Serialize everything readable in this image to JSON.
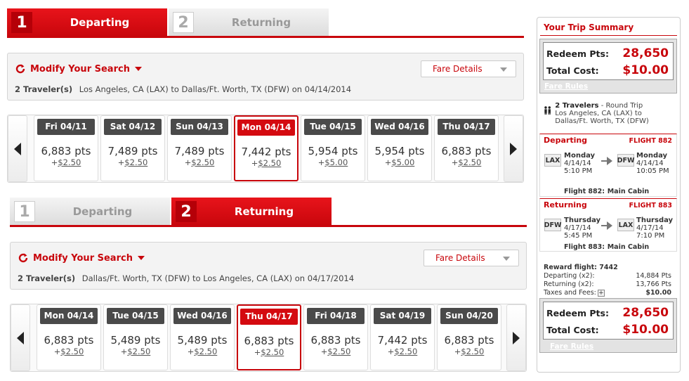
{
  "outbound": {
    "steps": [
      {
        "num": "1",
        "label": "Departing",
        "active": true
      },
      {
        "num": "2",
        "label": "Returning",
        "active": false
      }
    ],
    "modify_label": "Modify Your Search",
    "fare_details_label": "Fare Details",
    "travelers": "2 Traveler(s)",
    "route": "Los Angeles, CA (LAX) to Dallas/Ft. Worth, TX (DFW) on 04/14/2014",
    "days": [
      {
        "date": "Fri 04/11",
        "pts": "6,883 pts",
        "fee": "$2.50",
        "selected": false
      },
      {
        "date": "Sat 04/12",
        "pts": "7,489 pts",
        "fee": "$2.50",
        "selected": false
      },
      {
        "date": "Sun 04/13",
        "pts": "7,489 pts",
        "fee": "$2.50",
        "selected": false
      },
      {
        "date": "Mon 04/14",
        "pts": "7,442 pts",
        "fee": "$2.50",
        "selected": true
      },
      {
        "date": "Tue 04/15",
        "pts": "5,954 pts",
        "fee": "$5.00",
        "selected": false
      },
      {
        "date": "Wed 04/16",
        "pts": "5,954 pts",
        "fee": "$5.00",
        "selected": false
      },
      {
        "date": "Thu 04/17",
        "pts": "6,883 pts",
        "fee": "$2.50",
        "selected": false
      }
    ]
  },
  "inbound": {
    "steps": [
      {
        "num": "1",
        "label": "Departing",
        "active": false
      },
      {
        "num": "2",
        "label": "Returning",
        "active": true
      }
    ],
    "modify_label": "Modify Your Search",
    "fare_details_label": "Fare Details",
    "travelers": "2 Traveler(s)",
    "route": "Dallas/Ft. Worth, TX (DFW) to Los Angeles, CA (LAX) on 04/17/2014",
    "days": [
      {
        "date": "Mon 04/14",
        "pts": "6,883 pts",
        "fee": "$2.50",
        "selected": false
      },
      {
        "date": "Tue 04/15",
        "pts": "5,489 pts",
        "fee": "$2.50",
        "selected": false
      },
      {
        "date": "Wed 04/16",
        "pts": "5,489 pts",
        "fee": "$2.50",
        "selected": false
      },
      {
        "date": "Thu 04/17",
        "pts": "6,883 pts",
        "fee": "$2.50",
        "selected": true
      },
      {
        "date": "Fri 04/18",
        "pts": "6,883 pts",
        "fee": "$2.50",
        "selected": false
      },
      {
        "date": "Sat 04/19",
        "pts": "7,442 pts",
        "fee": "$2.50",
        "selected": false
      },
      {
        "date": "Sun 04/20",
        "pts": "6,883 pts",
        "fee": "$2.50",
        "selected": false
      }
    ]
  },
  "summary": {
    "title": "Your Trip Summary",
    "redeem_label": "Redeem Pts:",
    "redeem_value": "28,650",
    "total_label": "Total Cost:",
    "total_value": "$10.00",
    "fare_rules": "Fare Rules",
    "travelers_bold": "2 Travelers",
    "trip_type": " - Round Trip",
    "trip_route": "Los Angeles, CA (LAX) to Dallas/Ft. Worth, TX (DFW)",
    "departing": {
      "label": "Departing",
      "flight_tag": "FLIGHT 882",
      "from_code": "LAX",
      "from_day": "Monday",
      "from_date": "4/14/14",
      "from_time": "5:10 PM",
      "to_code": "DFW",
      "to_day": "Monday",
      "to_date": "4/14/14",
      "to_time": "10:05 PM",
      "flight": "Flight 882:",
      "cabin": "Main Cabin"
    },
    "returning": {
      "label": "Returning",
      "flight_tag": "FLIGHT 883",
      "from_code": "DFW",
      "from_day": "Thursday",
      "from_date": "4/17/14",
      "from_time": "5:45 PM",
      "to_code": "LAX",
      "to_day": "Thursday",
      "to_date": "4/17/14",
      "to_time": "7:10 PM",
      "flight": "Flight 883:",
      "cabin": "Main Cabin"
    },
    "reward": {
      "heading": "Reward flight: 7442",
      "departing_label": "Departing (x2):",
      "departing_value": "14,884 Pts",
      "returning_label": "Returning (x2):",
      "returning_value": "13,766 Pts",
      "taxes_label": "Taxes and Fees:",
      "taxes_value": "$10.00",
      "expand_glyph": "+"
    }
  }
}
